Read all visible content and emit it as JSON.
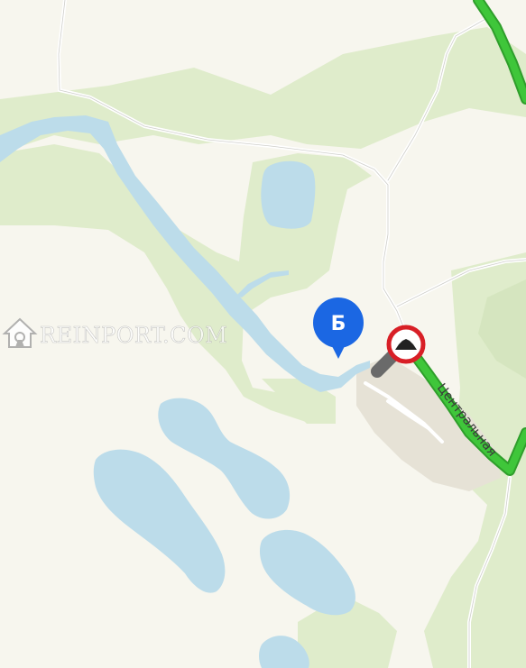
{
  "map": {
    "street_label": "Центральная",
    "marker_letter": "Б",
    "watermark": "REINPORT.COM",
    "icons": {
      "destination_marker": "map-pin-b",
      "road_sign": "speed-bump-sign",
      "watermark_logo": "house-logo"
    },
    "colors": {
      "land": "#f7f6ee",
      "forest": "#dfeccb",
      "water": "#bcdcea",
      "route": "#3fc63a",
      "marker": "#1b67e3",
      "sign_border": "#d81f26"
    }
  }
}
